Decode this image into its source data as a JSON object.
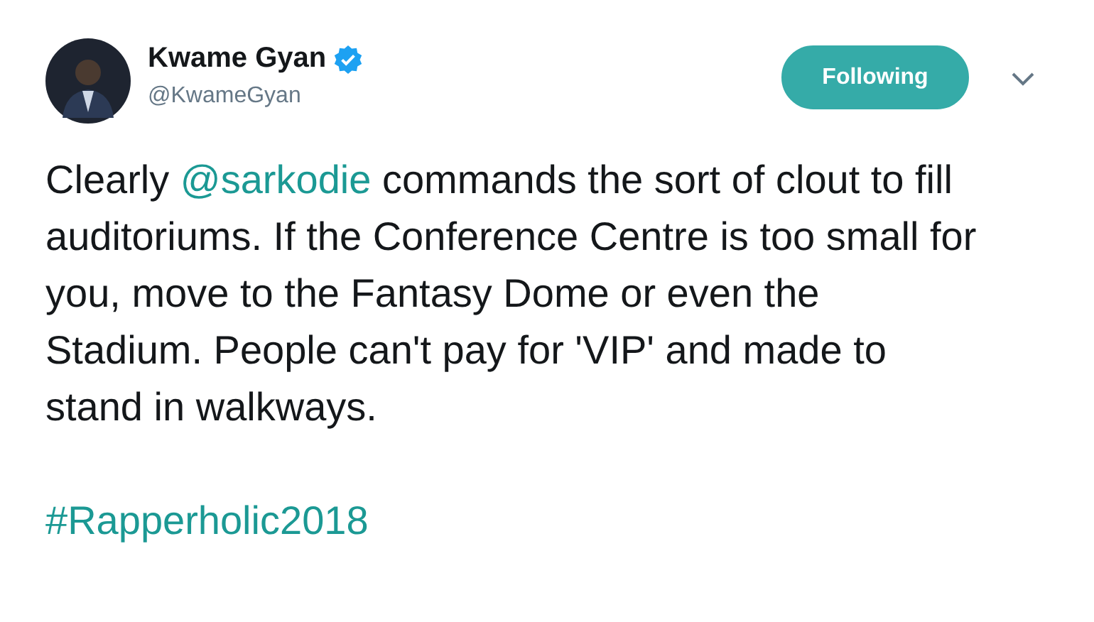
{
  "author": {
    "name": "Kwame Gyan",
    "verified": true,
    "handle": "@KwameGyan"
  },
  "follow_button": {
    "label": "Following",
    "following": true
  },
  "tweet": {
    "text_before": "Clearly ",
    "mention": "@sarkodie",
    "text_after": " commands the sort of clout to fill auditoriums. If the Conference Centre is too small for you, move to the Fantasy Dome or even the Stadium. People can't pay for 'VIP' and made to stand in walkways.",
    "hashtag": "#Rapperholic2018"
  }
}
